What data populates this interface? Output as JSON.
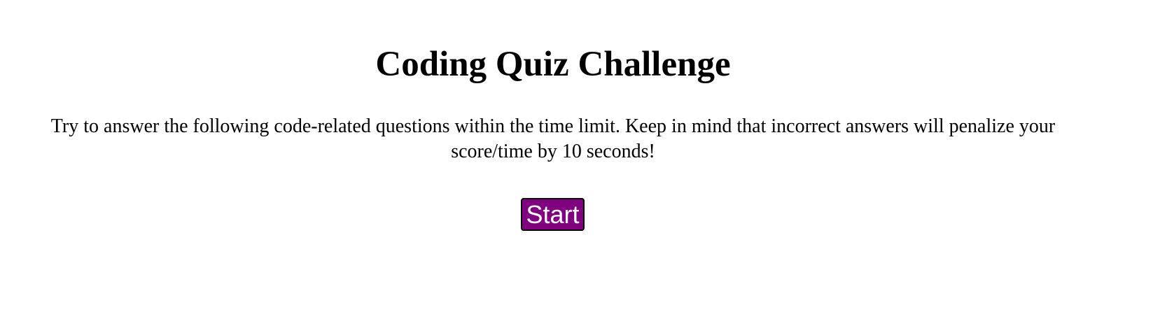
{
  "page": {
    "title": "Coding Quiz Challenge",
    "description": "Try to answer the following code-related questions within the time limit. Keep in mind that incorrect answers will penalize your score/time by 10 seconds!",
    "start_label": "Start"
  },
  "colors": {
    "background": "#ffffff",
    "text": "#000000",
    "button_background": "#800080",
    "button_text": "#ffffff",
    "button_border": "#000000"
  }
}
